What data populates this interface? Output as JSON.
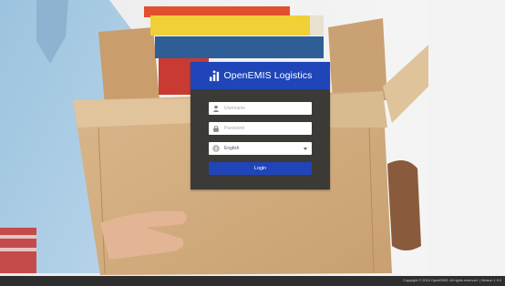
{
  "brand": {
    "name": "OpenEMIS Logistics",
    "color": "#1f45b8"
  },
  "login_form": {
    "username": {
      "placeholder": "Username",
      "value": "",
      "icon": "user-icon"
    },
    "password": {
      "placeholder": "Password",
      "value": "",
      "icon": "lock-icon"
    },
    "language": {
      "selected": "English",
      "icon": "globe-icon"
    },
    "login_label": "Login"
  },
  "footer": {
    "copyright": "Copyright © 2015 OpenEMIS. All rights reserved. | Version 1.0.0"
  },
  "colors": {
    "panel": "#3b3a37",
    "accent": "#1f45b8",
    "footer": "#2e2e2e"
  }
}
